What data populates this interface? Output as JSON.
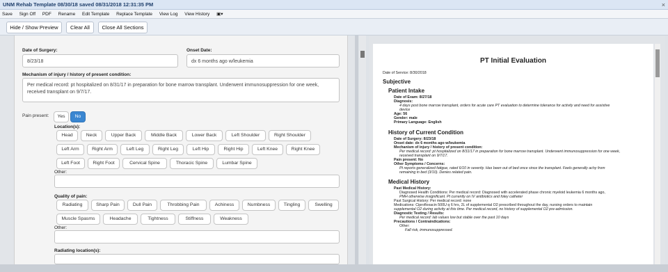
{
  "window": {
    "title": "UNM Rehab Template 08/30/18 saved 08/31/2018 12:31:35 PM",
    "close": "×"
  },
  "menu": [
    "Save",
    "Sign Off",
    "PDF",
    "Rename",
    "Edit Template",
    "Replace Template",
    "View Log",
    "View History",
    "▣▾"
  ],
  "toolbar": {
    "hide_show": "Hide / Show Preview",
    "clear_all": "Clear All",
    "close_all": "Close All Sections"
  },
  "form": {
    "surgery_label": "Date of Surgery:",
    "surgery_value": "8/23/18",
    "onset_label": "Onset Date:",
    "onset_value": "dx 6 months ago w/leukemia",
    "mechanism_label": "Mechanism of injury / history of present condition:",
    "mechanism_value": "Per medical record: pt hospitalized on 8/31/17 in preparation for bone marrow transplant.  Underwent immunosuppression for one week, received transplant on 9/7/17.",
    "pain_label": "Pain present:",
    "yes": "Yes",
    "no": "No",
    "location_label": "Location(s):",
    "locations": [
      "Head",
      "Neck",
      "Upper Back",
      "Middle Back",
      "Lower Back",
      "Left Shoulder",
      "Right Shoulder",
      "Left Arm",
      "Right Arm",
      "Left Leg",
      "Right Leg",
      "Left Hip",
      "Right Hip",
      "Left Knee",
      "Right Knee",
      "Left Foot",
      "Right Foot",
      "Cervical Spine",
      "Thoracic Spine",
      "Lumbar Spine"
    ],
    "other_label": "Other:",
    "quality_label": "Quality of pain:",
    "qualities": [
      "Radiating",
      "Sharp Pain",
      "Dull Pain",
      "Throbbing Pain",
      "Achiness",
      "Numbness",
      "Tingling",
      "Swelling",
      "Muscle Spasms",
      "Headache",
      "Tightness",
      "Stiffness",
      "Weakness"
    ],
    "other2_label": "Other:",
    "radiating_label": "Radiating location(s):"
  },
  "preview": {
    "title": "PT Initial Evaluation",
    "date_of_service": "Date of Service: 8/30/2018",
    "subjective": "Subjective",
    "intake_heading": "Patient Intake",
    "date_exam": "Date of Exam: 8/27/18",
    "diagnosis_label": "Diagnosis:",
    "diagnosis_1": "4 days post bone marrow transplant, orders for acute care PT evaluation to determine tolerance for activity and need for assistive",
    "diagnosis_2": "device",
    "age": "Age: 56",
    "gender": "Gender: male",
    "language": "Primary Language: English",
    "history_heading": "History of Current Condition",
    "h_surgery": "Date of Surgery: 8/23/18",
    "h_onset": "Onset date: dx 6 months ago w/leukemia",
    "h_mech_label": "Mechanism of injury / history of present condition:",
    "h_mech_1": "Per medical record: pt hospitalized on 8/31/17 in preparation for bone marrow transplant.  Underwent immunosuppression for one week,",
    "h_mech_2": "received transplant on 9/7/17.",
    "h_pain": "Pain present: No",
    "h_other_label": "Other Symptoms / Concerns:",
    "h_other_1": "Pt reports generalized fatigue, rated 6/10 in severity.  Has been out of bed once since the transplant.  Feels generally achy from",
    "h_other_2": "remaining in bed (3/10).  Denies related pain.",
    "med_heading": "Medical History",
    "pmh_label": "Past Medical History:",
    "dhc_1": "Diagnosed Health Conditions: Per medical record: Diagnosed with accelerated phase chronic myeloid leukemia 6 months ago,",
    "dhc_2": "PMH otherwise insignificant. Pt currently on IV antibiotics and foley catheter",
    "psh": "Past Surgical History: Per medical record: none",
    "meds_1": "Medications: Ciprofloxacin 500U q 6 hrs, 2L of supplemental O2 prescribed throughout the day, nursing orders to maintain",
    "meds_2": "supplemental O2 during activity at this time. Per medical record, no history of supplemental O2 pre-admission.",
    "diag_label": "Diagnostic Testing / Results:",
    "diag_value": "Per medical record: lab values low but stable over the past 10 days",
    "prec_label": "Precautions / Contraindications:",
    "prec_other": "Other:",
    "prec_value": "Fall risk, immunosuppressed."
  }
}
